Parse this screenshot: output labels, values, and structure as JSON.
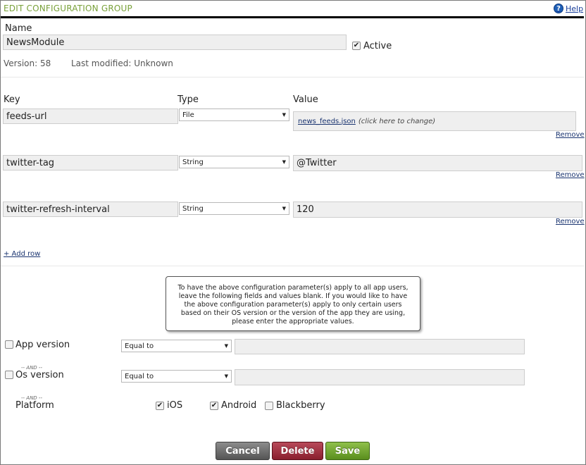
{
  "header": {
    "title": "EDIT CONFIGURATION GROUP",
    "help_label": "Help",
    "help_icon": "?"
  },
  "group": {
    "name_label": "Name",
    "name_value": "NewsModule",
    "active_label": "Active",
    "active_checked": true,
    "version_text": "Version: 58",
    "modified_text": "Last modified: Unknown"
  },
  "params": {
    "col_key": "Key",
    "col_type": "Type",
    "col_value": "Value",
    "rows": [
      {
        "key": "feeds-url",
        "type": "File",
        "value_file": "news_feeds.json",
        "value_hint": "(click here to change)",
        "remove": "Remove"
      },
      {
        "key": "twitter-tag",
        "type": "String",
        "value": "@Twitter",
        "remove": "Remove"
      },
      {
        "key": "twitter-refresh-interval",
        "type": "String",
        "value": "120",
        "remove": "Remove"
      }
    ],
    "add_row": "+ Add row"
  },
  "filters": {
    "note": "To have the above configuration parameter(s) apply to all app users, leave the following fields and values blank. If you would like to have the above configuration parameter(s) apply to only certain users based on their OS version or the version of the app they are using, please enter the appropriate values.",
    "and_text": "-- AND --",
    "app_version": {
      "label": "App version",
      "operator": "Equal to",
      "value": "",
      "checked": false
    },
    "os_version": {
      "label": "Os version",
      "operator": "Equal to",
      "value": "",
      "checked": false
    },
    "platform": {
      "label": "Platform",
      "options": [
        {
          "label": "iOS",
          "checked": true
        },
        {
          "label": "Android",
          "checked": true
        },
        {
          "label": "Blackberry",
          "checked": false
        }
      ]
    }
  },
  "actions": {
    "cancel": "Cancel",
    "delete": "Delete",
    "save": "Save"
  },
  "colors": {
    "header_title": "#79a13a",
    "cancel": "#6e6e6e",
    "delete": "#a3303f",
    "save": "#72a533"
  },
  "icons": {
    "help": "help-icon",
    "checkmark": "check-icon",
    "dropdown": "chevron-down-icon"
  }
}
